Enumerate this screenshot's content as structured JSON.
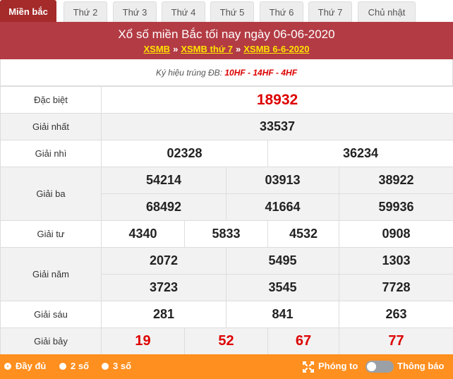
{
  "tabs": [
    "Miền bắc",
    "Thứ 2",
    "Thứ 3",
    "Thứ 4",
    "Thứ 5",
    "Thứ 6",
    "Thứ 7",
    "Chủ nhật"
  ],
  "header": {
    "title": "Xổ số miền Bắc tối nay ngày 06-06-2020",
    "link1": "XSMB",
    "link2": "XSMB thứ 7",
    "link3": "XSMB 6-6-2020",
    "sep": "»"
  },
  "code_row": {
    "label": "Ký hiệu trúng ĐB: ",
    "codes": "10HF - 14HF - 4HF"
  },
  "prizes": {
    "db": {
      "label": "Đặc biệt",
      "values": [
        "18932"
      ]
    },
    "g1": {
      "label": "Giải nhất",
      "values": [
        "33537"
      ]
    },
    "g2": {
      "label": "Giải nhì",
      "values": [
        "02328",
        "36234"
      ]
    },
    "g3": {
      "label": "Giải ba",
      "values": [
        "54214",
        "03913",
        "38922",
        "68492",
        "41664",
        "59936"
      ]
    },
    "g4": {
      "label": "Giải tư",
      "values": [
        "4340",
        "5833",
        "4532",
        "0908"
      ]
    },
    "g5": {
      "label": "Giải năm",
      "values": [
        "2072",
        "5495",
        "1303",
        "3723",
        "3545",
        "7728"
      ]
    },
    "g6": {
      "label": "Giải sáu",
      "values": [
        "281",
        "841",
        "263"
      ]
    },
    "g7": {
      "label": "Giải bảy",
      "values": [
        "19",
        "52",
        "67",
        "77"
      ]
    }
  },
  "footer": {
    "opt_full": "Đầy đủ",
    "opt_2": "2 số",
    "opt_3": "3 số",
    "zoom": "Phóng to",
    "notify": "Thông báo"
  },
  "colors": {
    "header_bg": "#b33b44",
    "active_tab": "#a52a2a",
    "footer_bg": "#ff8f1f",
    "highlight": "#dd0000",
    "link": "#ffe400"
  }
}
